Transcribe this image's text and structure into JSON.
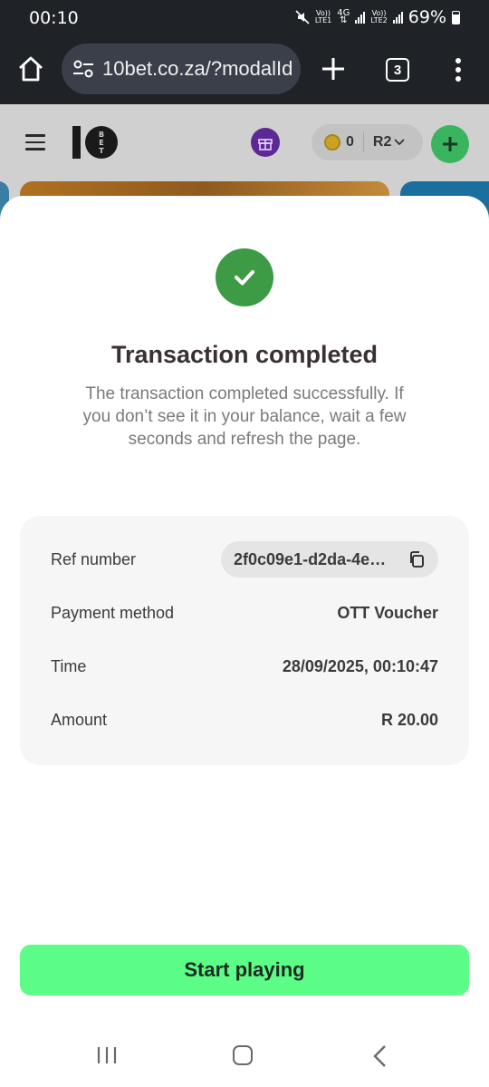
{
  "status_bar": {
    "time": "00:10",
    "sim1_label_top": "Vo))",
    "sim1_label_bottom": "LTE1",
    "network_type": "4G",
    "sim2_label_top": "Vo))",
    "sim2_label_bottom": "LTE2",
    "battery": "69%"
  },
  "browser": {
    "url": "10bet.co.za/?modalId",
    "tab_count": "3"
  },
  "site_header": {
    "coin_count": "0",
    "balance": "R2"
  },
  "modal": {
    "title": "Transaction completed",
    "description": "The transaction completed successfully. If you don’t see it in your balance, wait a few seconds and refresh the page.",
    "details": {
      "ref_label": "Ref number",
      "ref_value": "2f0c09e1-d2da-4e…",
      "method_label": "Payment method",
      "method_value": "OTT Voucher",
      "time_label": "Time",
      "time_value": "28/09/2025, 00:10:47",
      "amount_label": "Amount",
      "amount_value": "R 20.00"
    },
    "primary_button": "Start playing"
  },
  "colors": {
    "success": "#3d9a45",
    "cta": "#5bfd86",
    "gift": "#5d2896",
    "deposit": "#3bb460"
  }
}
